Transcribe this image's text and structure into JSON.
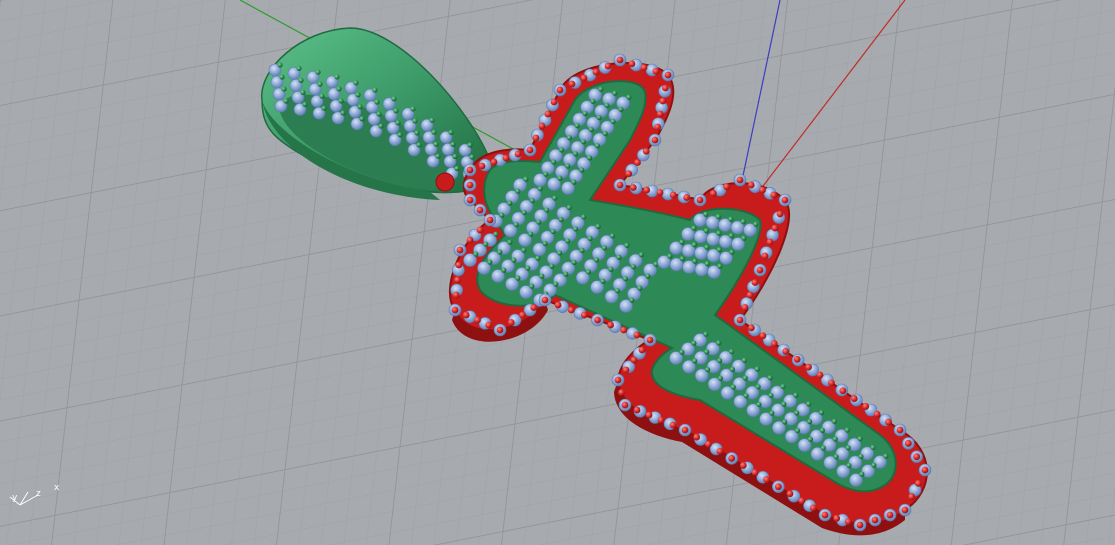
{
  "viewport": {
    "background_color": "#a7abaf",
    "grid_minor_color": "#9ea2a6",
    "grid_major_color": "#8d9195"
  },
  "world_axes": {
    "x_color": "#c42a2a",
    "y_color": "#2f9c2f",
    "z_color": "#3d3dbd"
  },
  "axis_gizmo": {
    "x_label": "x",
    "y_label": "y",
    "z_label": "z",
    "color": "#ffffff"
  },
  "model": {
    "cross_base_color": "#c81c1c",
    "cross_base_dark": "#8e1010",
    "raised_layer_color": "#2d8a56",
    "raised_layer_dark": "#1f6a40",
    "bail_color": "#3c9a68",
    "stone_color": "#8ea9d6",
    "prong_red": "#d22828",
    "prong_green": "#2e8a50"
  }
}
